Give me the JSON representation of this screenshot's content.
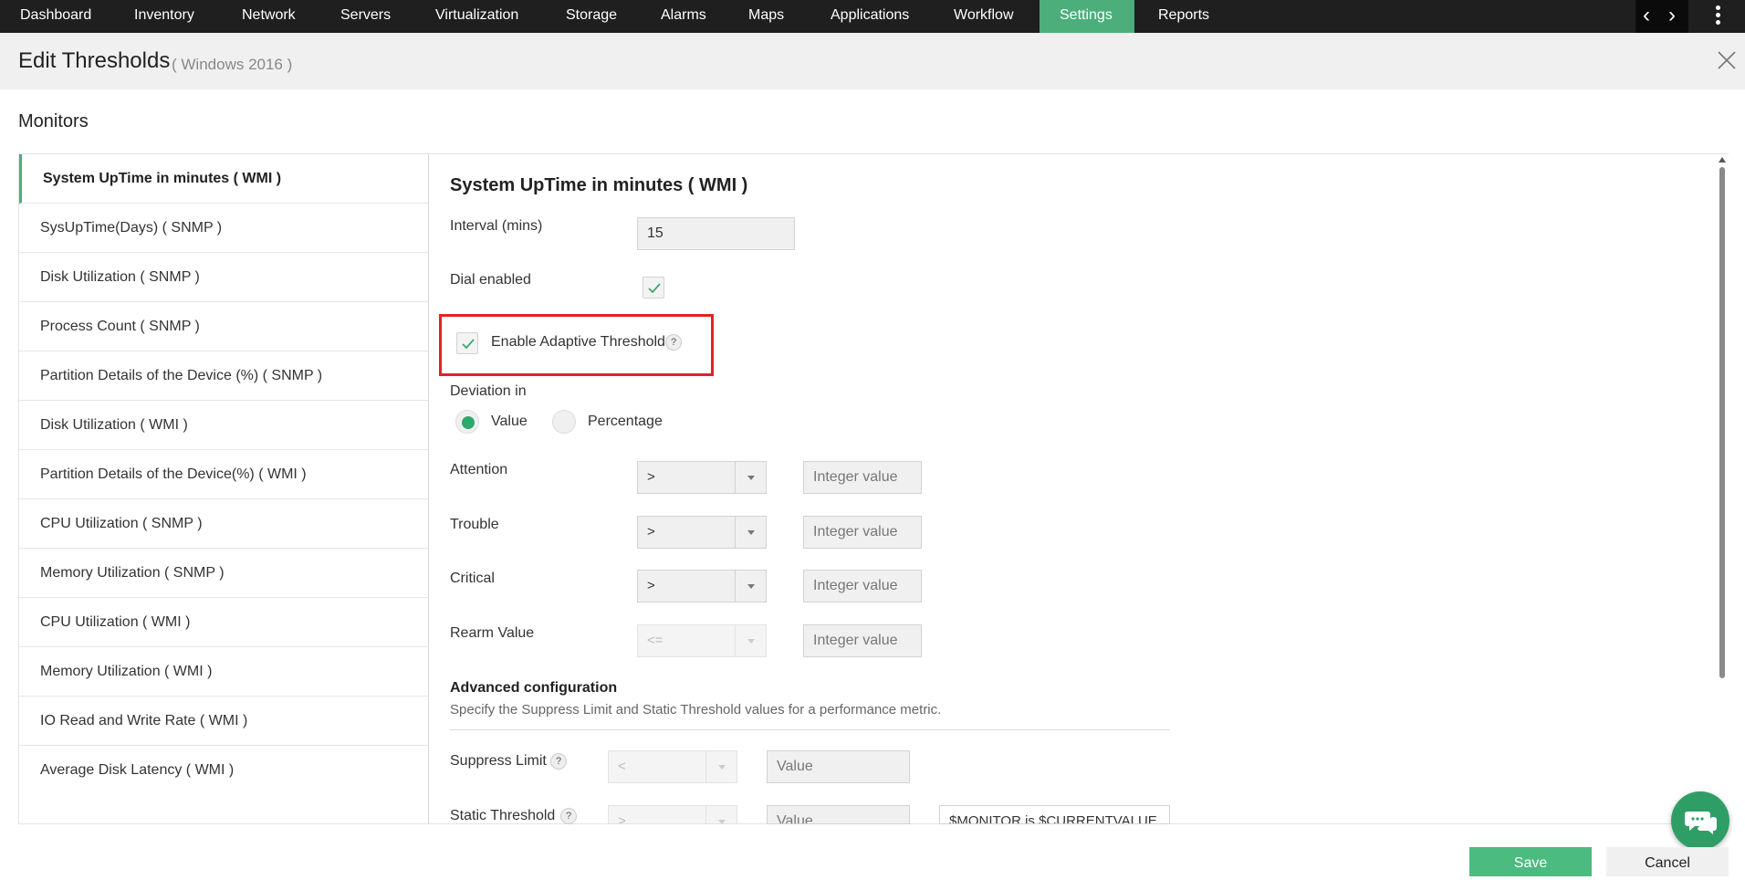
{
  "nav": {
    "items": [
      "Dashboard",
      "Inventory",
      "Network",
      "Servers",
      "Virtualization",
      "Storage",
      "Alarms",
      "Maps",
      "Applications",
      "Workflow",
      "Settings",
      "Reports"
    ],
    "active": "Settings"
  },
  "header": {
    "title": "Edit Thresholds",
    "subtitle": "( Windows 2016 )"
  },
  "monitors_heading": "Monitors",
  "monitors": [
    "System UpTime in minutes ( WMI )",
    "SysUpTime(Days) ( SNMP )",
    "Disk Utilization ( SNMP )",
    "Process Count ( SNMP )",
    "Partition Details of the Device (%) ( SNMP )",
    "Disk Utilization ( WMI )",
    "Partition Details of the Device(%) ( WMI )",
    "CPU Utilization ( SNMP )",
    "Memory Utilization ( SNMP )",
    "CPU Utilization ( WMI )",
    "Memory Utilization ( WMI )",
    "IO Read and Write Rate ( WMI )",
    "Average Disk Latency ( WMI )"
  ],
  "panel": {
    "title": "System UpTime in minutes ( WMI )",
    "interval_label": "Interval (mins)",
    "interval_value": "15",
    "dial_label": "Dial enabled",
    "dial_checked": true,
    "adaptive_label": "Enable Adaptive Threshold",
    "adaptive_checked": true,
    "help_glyph": "?",
    "deviation_label": "Deviation in",
    "deviation_value": "Value",
    "deviation_percentage": "Percentage",
    "thresholds": [
      {
        "label": "Attention",
        "op": ">",
        "placeholder": "Integer value"
      },
      {
        "label": "Trouble",
        "op": ">",
        "placeholder": "Integer value"
      },
      {
        "label": "Critical",
        "op": ">",
        "placeholder": "Integer value"
      },
      {
        "label": "Rearm Value",
        "op": "<=",
        "placeholder": "Integer value"
      }
    ],
    "advanced_title": "Advanced configuration",
    "advanced_desc": "Specify the Suppress Limit and Static Threshold values for a performance metric.",
    "suppress_label": "Suppress Limit",
    "suppress_op": "<",
    "suppress_placeholder": "Value",
    "static_label": "Static Threshold",
    "static_op": ">",
    "static_placeholder": "Value",
    "static_message": "$MONITOR is $CURRENTVALUE"
  },
  "buttons": {
    "save": "Save",
    "cancel": "Cancel"
  },
  "colors": {
    "accent": "#4cae7b",
    "highlight": "#e0222b",
    "nav_bg": "#1f1f1f"
  }
}
